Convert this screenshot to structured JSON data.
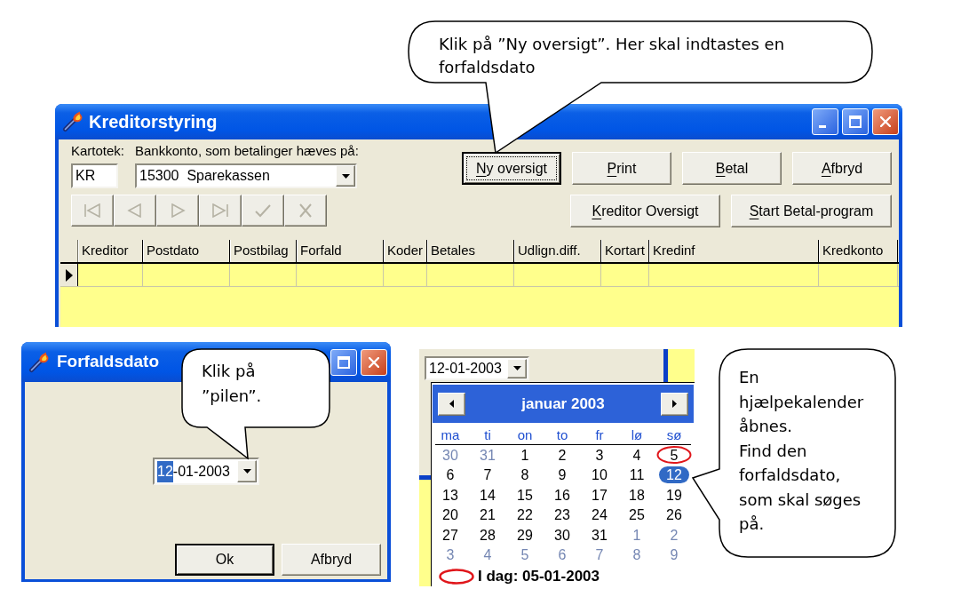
{
  "hint_new_overview": {
    "text": "Klik på ”Ny oversigt”. Her skal indtastes en forfaldsdato"
  },
  "main_window": {
    "title": "Kreditorstyring",
    "kartotek_label": "Kartotek:",
    "bank_account_label": "Bankkonto, som betalinger hæves på:",
    "kartotek_field": {
      "value": "KR"
    },
    "bank_account_combo": {
      "value": "15300  Sparekassen"
    },
    "navigator": [
      {
        "kind": "first",
        "disabled": true
      },
      {
        "kind": "prior",
        "disabled": true
      },
      {
        "kind": "next",
        "disabled": true
      },
      {
        "kind": "last",
        "disabled": true
      },
      {
        "kind": "post",
        "disabled": true
      },
      {
        "kind": "cancel",
        "disabled": true
      }
    ],
    "button_rows": [
      {
        "buttons": [
          {
            "label": "Ny oversigt",
            "mnemonic": true,
            "default": true,
            "focused": true
          },
          {
            "label": "Print",
            "mnemonic": true,
            "default": false,
            "focused": false
          },
          {
            "label": "Betal",
            "mnemonic": true,
            "default": false,
            "focused": false
          },
          {
            "label": "Afbryd",
            "mnemonic": true,
            "default": false,
            "focused": false
          }
        ]
      },
      {
        "buttons": [
          {
            "label": "Kreditor Oversigt",
            "mnemonic": true,
            "default": false,
            "focused": false
          },
          {
            "label": "Start Betal-program",
            "mnemonic": true,
            "default": false,
            "focused": false
          }
        ]
      }
    ],
    "grid": {
      "columns": [
        "Kreditor",
        "Postdato",
        "Postbilag",
        "Forfald",
        "Koder",
        "Betales",
        "Udlign.diff.",
        "Kortart",
        "Kredinf",
        "Kredkonto"
      ],
      "rows": [
        {
          "selected": true
        }
      ]
    }
  },
  "date_dialog": {
    "title": "Forfaldsdato",
    "hint": {
      "text": "Klik på ”pilen”."
    },
    "date_picker": {
      "segments": [
        {
          "text": "12",
          "selected": true
        },
        {
          "text": "-01-2003",
          "selected": false
        }
      ]
    },
    "buttons": [
      {
        "label": "Ok",
        "mnemonic": false,
        "default": true,
        "focused": false
      },
      {
        "label": "Afbryd",
        "mnemonic": false,
        "default": false,
        "focused": false
      }
    ]
  },
  "calendar_view": {
    "date_picker": {
      "value": "12-01-2003"
    },
    "month_label": "januar 2003",
    "weekdays": [
      "ma",
      "ti",
      "on",
      "to",
      "fr",
      "lø",
      "sø"
    ],
    "weeks": [
      [
        {
          "day": "30",
          "outside_month": true,
          "today": false,
          "selected": false
        },
        {
          "day": "31",
          "outside_month": true,
          "today": false,
          "selected": false
        },
        {
          "day": "1",
          "outside_month": false,
          "today": false,
          "selected": false
        },
        {
          "day": "2",
          "outside_month": false,
          "today": false,
          "selected": false
        },
        {
          "day": "3",
          "outside_month": false,
          "today": false,
          "selected": false
        },
        {
          "day": "4",
          "outside_month": false,
          "today": false,
          "selected": false
        },
        {
          "day": "5",
          "outside_month": false,
          "today": true,
          "selected": false
        }
      ],
      [
        {
          "day": "6",
          "outside_month": false,
          "today": false,
          "selected": false
        },
        {
          "day": "7",
          "outside_month": false,
          "today": false,
          "selected": false
        },
        {
          "day": "8",
          "outside_month": false,
          "today": false,
          "selected": false
        },
        {
          "day": "9",
          "outside_month": false,
          "today": false,
          "selected": false
        },
        {
          "day": "10",
          "outside_month": false,
          "today": false,
          "selected": false
        },
        {
          "day": "11",
          "outside_month": false,
          "today": false,
          "selected": false
        },
        {
          "day": "12",
          "outside_month": false,
          "today": false,
          "selected": true
        }
      ],
      [
        {
          "day": "13",
          "outside_month": false,
          "today": false,
          "selected": false
        },
        {
          "day": "14",
          "outside_month": false,
          "today": false,
          "selected": false
        },
        {
          "day": "15",
          "outside_month": false,
          "today": false,
          "selected": false
        },
        {
          "day": "16",
          "outside_month": false,
          "today": false,
          "selected": false
        },
        {
          "day": "17",
          "outside_month": false,
          "today": false,
          "selected": false
        },
        {
          "day": "18",
          "outside_month": false,
          "today": false,
          "selected": false
        },
        {
          "day": "19",
          "outside_month": false,
          "today": false,
          "selected": false
        }
      ],
      [
        {
          "day": "20",
          "outside_month": false,
          "today": false,
          "selected": false
        },
        {
          "day": "21",
          "outside_month": false,
          "today": false,
          "selected": false
        },
        {
          "day": "22",
          "outside_month": false,
          "today": false,
          "selected": false
        },
        {
          "day": "23",
          "outside_month": false,
          "today": false,
          "selected": false
        },
        {
          "day": "24",
          "outside_month": false,
          "today": false,
          "selected": false
        },
        {
          "day": "25",
          "outside_month": false,
          "today": false,
          "selected": false
        },
        {
          "day": "26",
          "outside_month": false,
          "today": false,
          "selected": false
        }
      ],
      [
        {
          "day": "27",
          "outside_month": false,
          "today": false,
          "selected": false
        },
        {
          "day": "28",
          "outside_month": false,
          "today": false,
          "selected": false
        },
        {
          "day": "29",
          "outside_month": false,
          "today": false,
          "selected": false
        },
        {
          "day": "30",
          "outside_month": false,
          "today": false,
          "selected": false
        },
        {
          "day": "31",
          "outside_month": false,
          "today": false,
          "selected": false
        },
        {
          "day": "1",
          "outside_month": true,
          "today": false,
          "selected": false
        },
        {
          "day": "2",
          "outside_month": true,
          "today": false,
          "selected": false
        }
      ],
      [
        {
          "day": "3",
          "outside_month": true,
          "today": false,
          "selected": false
        },
        {
          "day": "4",
          "outside_month": true,
          "today": false,
          "selected": false
        },
        {
          "day": "5",
          "outside_month": true,
          "today": false,
          "selected": false
        },
        {
          "day": "6",
          "outside_month": true,
          "today": false,
          "selected": false
        },
        {
          "day": "7",
          "outside_month": true,
          "today": false,
          "selected": false
        },
        {
          "day": "8",
          "outside_month": true,
          "today": false,
          "selected": false
        },
        {
          "day": "9",
          "outside_month": true,
          "today": false,
          "selected": false
        }
      ]
    ],
    "today_label": "I dag: 05-01-2003"
  },
  "hint_calendar": {
    "paragraphs": [
      "En hjælpekalender åbnes.",
      "Find den forfaldsdato, som skal søges på."
    ]
  }
}
